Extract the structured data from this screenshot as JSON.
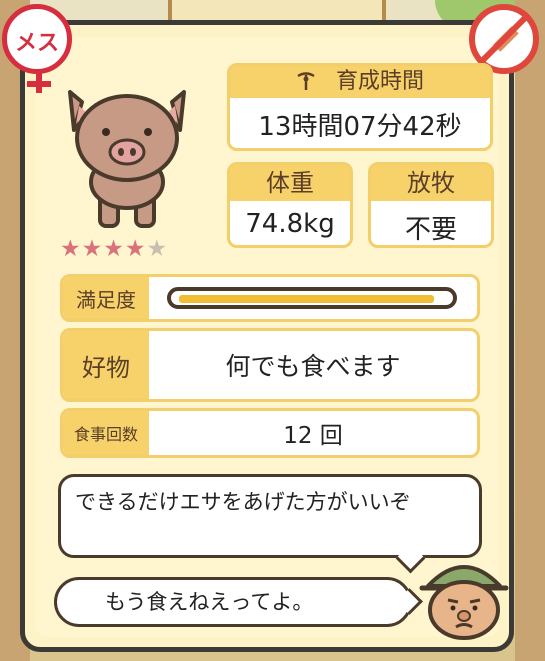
{
  "badges": {
    "gender_label": "メス",
    "gender_icon": "female-icon",
    "syringe_icon": "no-injection-icon",
    "colors": {
      "red": "#d62d3f"
    }
  },
  "pig": {
    "icon": "pig-icon"
  },
  "rating": {
    "value": 4,
    "max": 5
  },
  "growth_time": {
    "label": "育成時間",
    "value": "13時間07分42秒",
    "icon": "whistle-icon"
  },
  "weight": {
    "label": "体重",
    "value": "74.8kg"
  },
  "grazing": {
    "label": "放牧",
    "value": "不要"
  },
  "satisfaction": {
    "label": "満足度",
    "level": 0.96
  },
  "favorite": {
    "label": "好物",
    "value": "何でも食べます"
  },
  "meals": {
    "label": "食事回数",
    "value": "12 回"
  },
  "speech": [
    "できるだけエサをあげた方がいいぞ",
    "もう食えねえってよ。"
  ],
  "npc": {
    "icon": "farmer-avatar"
  },
  "colors": {
    "panel_bg": "#fff6cf",
    "accent": "#f7d26b",
    "border": "#3c3a36"
  }
}
